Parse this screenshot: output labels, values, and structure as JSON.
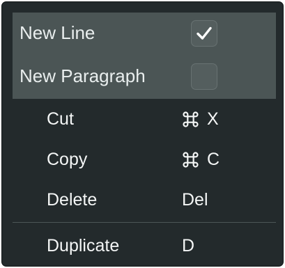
{
  "options": [
    {
      "label": "New Line",
      "checked": true
    },
    {
      "label": "New Paragraph",
      "checked": false
    }
  ],
  "menu_items": [
    {
      "label": "Cut",
      "shortcut_modifier_icon": "command-icon",
      "shortcut_key": "X"
    },
    {
      "label": "Copy",
      "shortcut_modifier_icon": "command-icon",
      "shortcut_key": "C"
    },
    {
      "label": "Delete",
      "shortcut_key": "Del"
    },
    {
      "label": "Duplicate",
      "shortcut_key": "D"
    }
  ],
  "colors": {
    "menu_background": "#232a2c",
    "options_background": "#4b5555",
    "checkbox_background": "#545e5e",
    "text": "#ffffff"
  }
}
